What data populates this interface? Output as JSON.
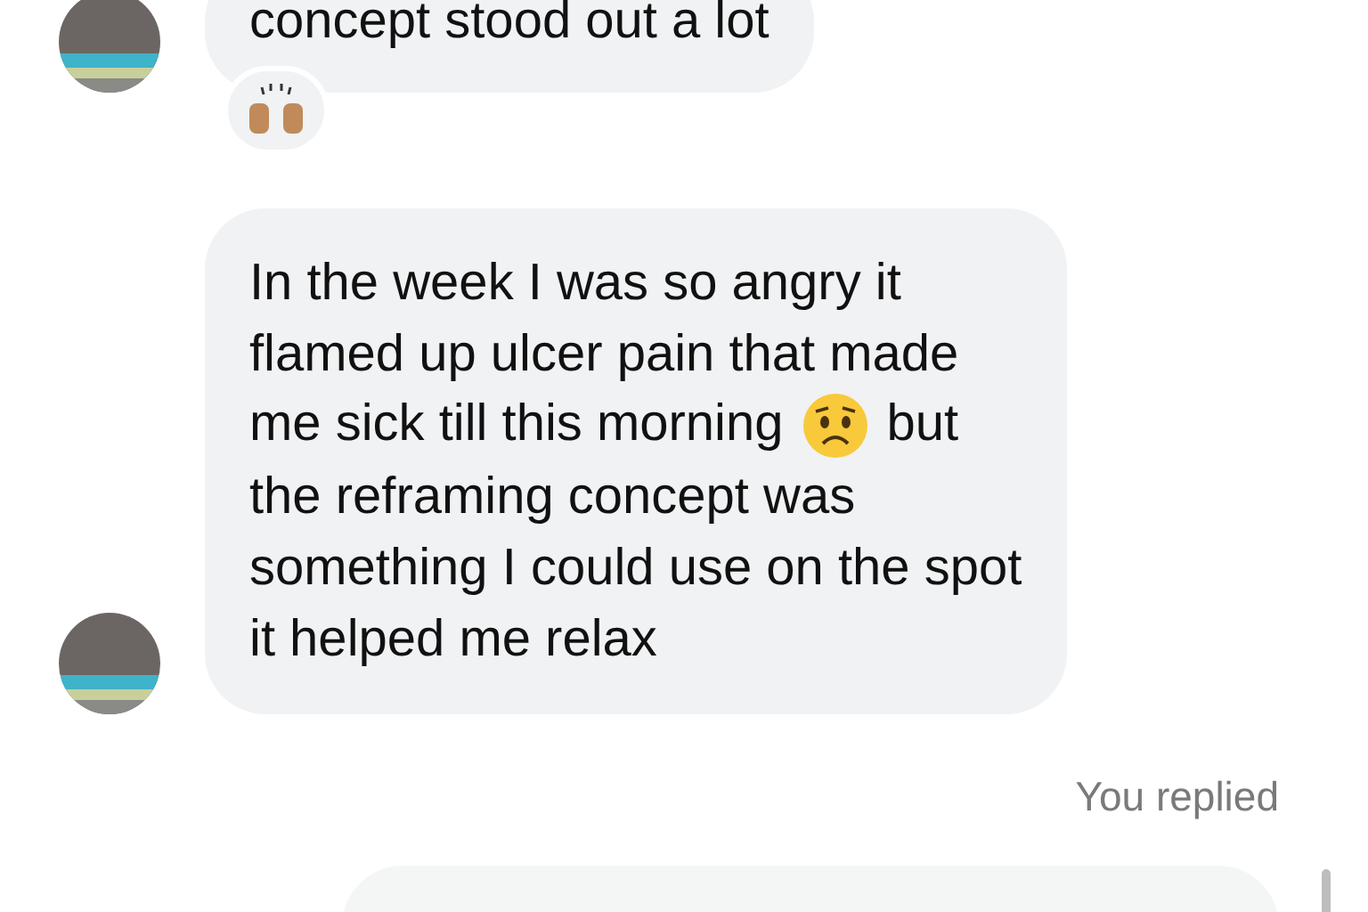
{
  "messages": [
    {
      "kind": "received",
      "lines": [
        {
          "text": "concept stood out a lot"
        }
      ],
      "reaction": true
    },
    {
      "kind": "received",
      "lines": [
        {
          "text": "In the week I was so angry it"
        },
        {
          "text": "flamed up ulcer pain that made"
        },
        {
          "text": "me sick till this morning",
          "after": "but",
          "kind": "emoji"
        },
        {
          "text": "the reframing concept was"
        },
        {
          "text": "something I could use on the spot"
        },
        {
          "text": "it helped me relax"
        }
      ],
      "reaction": false
    },
    {
      "kind": "reply_note",
      "text": "You replied"
    },
    {
      "kind": "sent"
    }
  ]
}
